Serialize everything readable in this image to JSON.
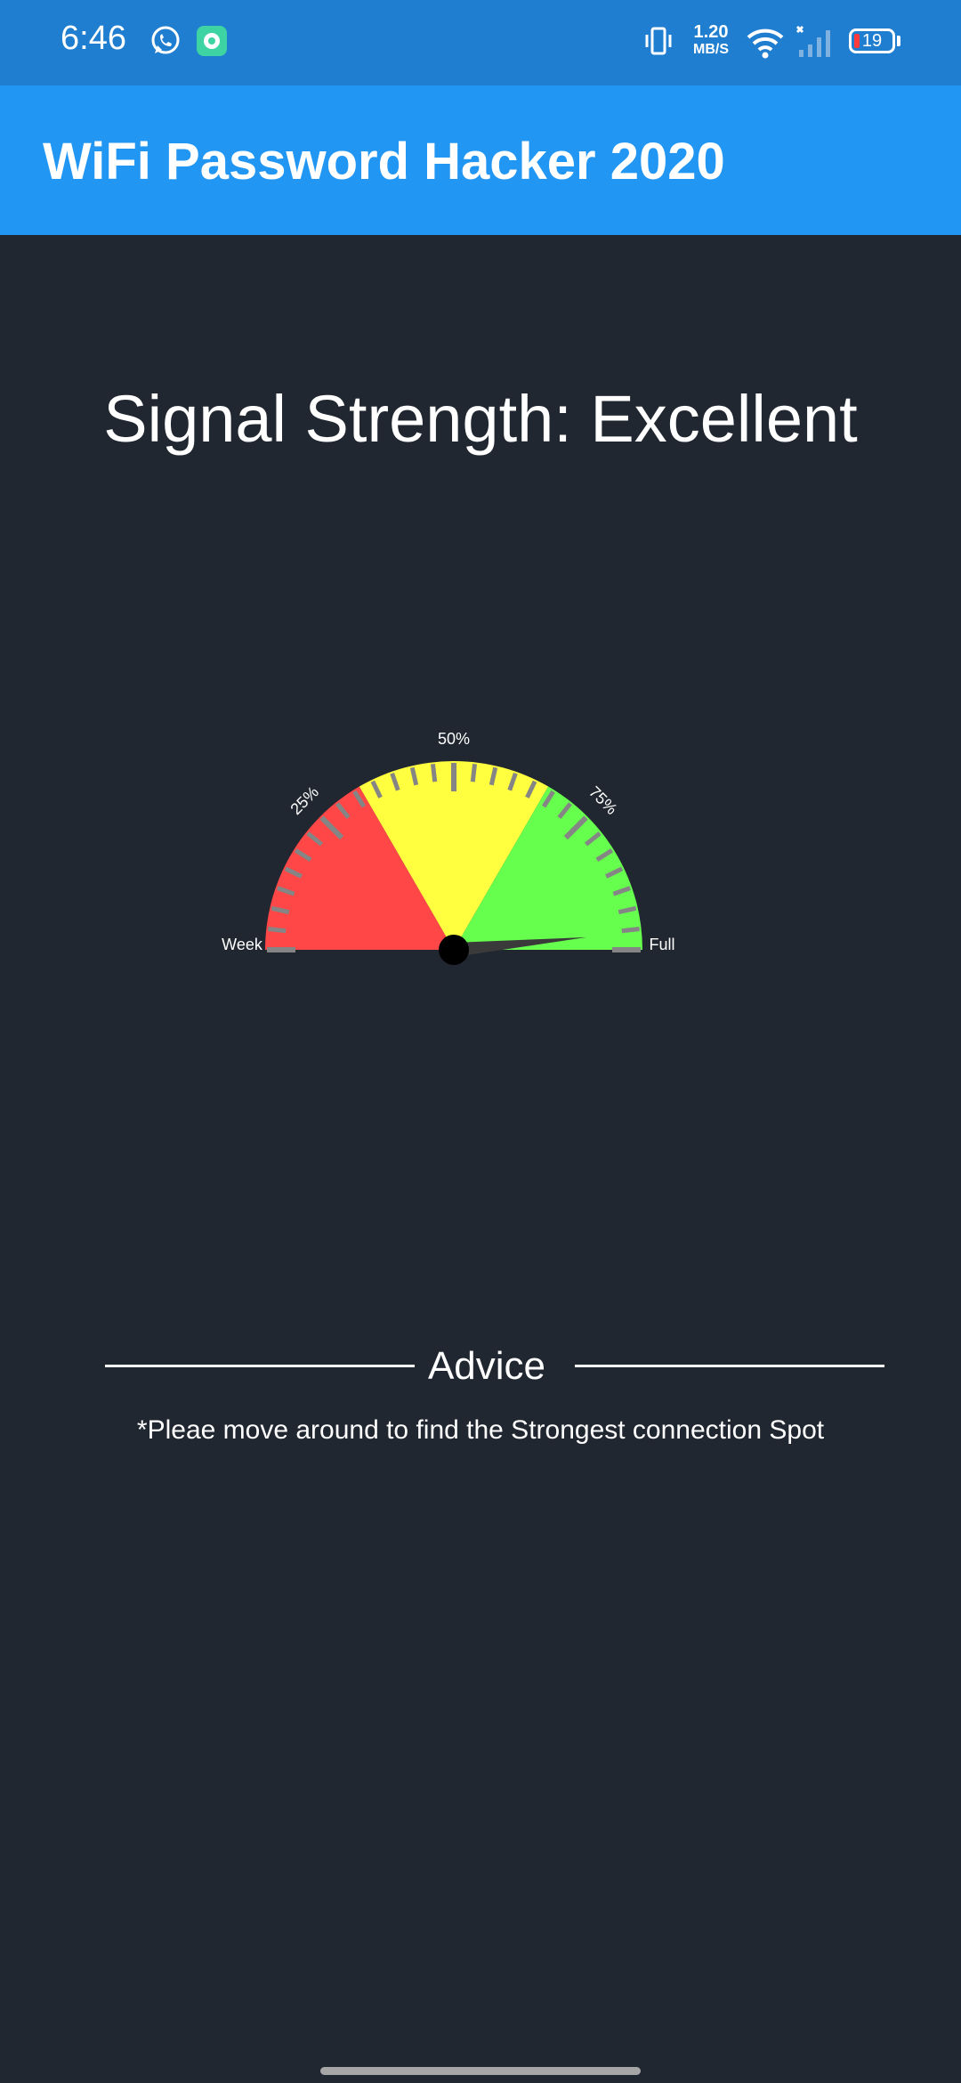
{
  "status_bar": {
    "time": "6:46",
    "speed_value": "1.20",
    "speed_unit": "MB/S",
    "battery": "19",
    "icons": [
      "whatsapp-icon",
      "app-notification-icon",
      "vibrate-icon",
      "wifi-icon",
      "signal-icon",
      "battery-icon"
    ]
  },
  "app_bar": {
    "title": "WiFi Password Hacker 2020"
  },
  "signal": {
    "heading": "Signal Strength: Excellent"
  },
  "gauge": {
    "labels": {
      "min": "Week",
      "p25": "25%",
      "p50": "50%",
      "p75": "75%",
      "max": "Full"
    },
    "needle_value": 0.97,
    "colors": {
      "low": "#ff4747",
      "mid": "#ffff3f",
      "high": "#66ff4d",
      "tick": "#858585",
      "needle": "#3a3a3a",
      "hub": "#000000"
    }
  },
  "advice": {
    "title": "Advice",
    "text": "*Pleae move around to find the Strongest connection Spot"
  }
}
